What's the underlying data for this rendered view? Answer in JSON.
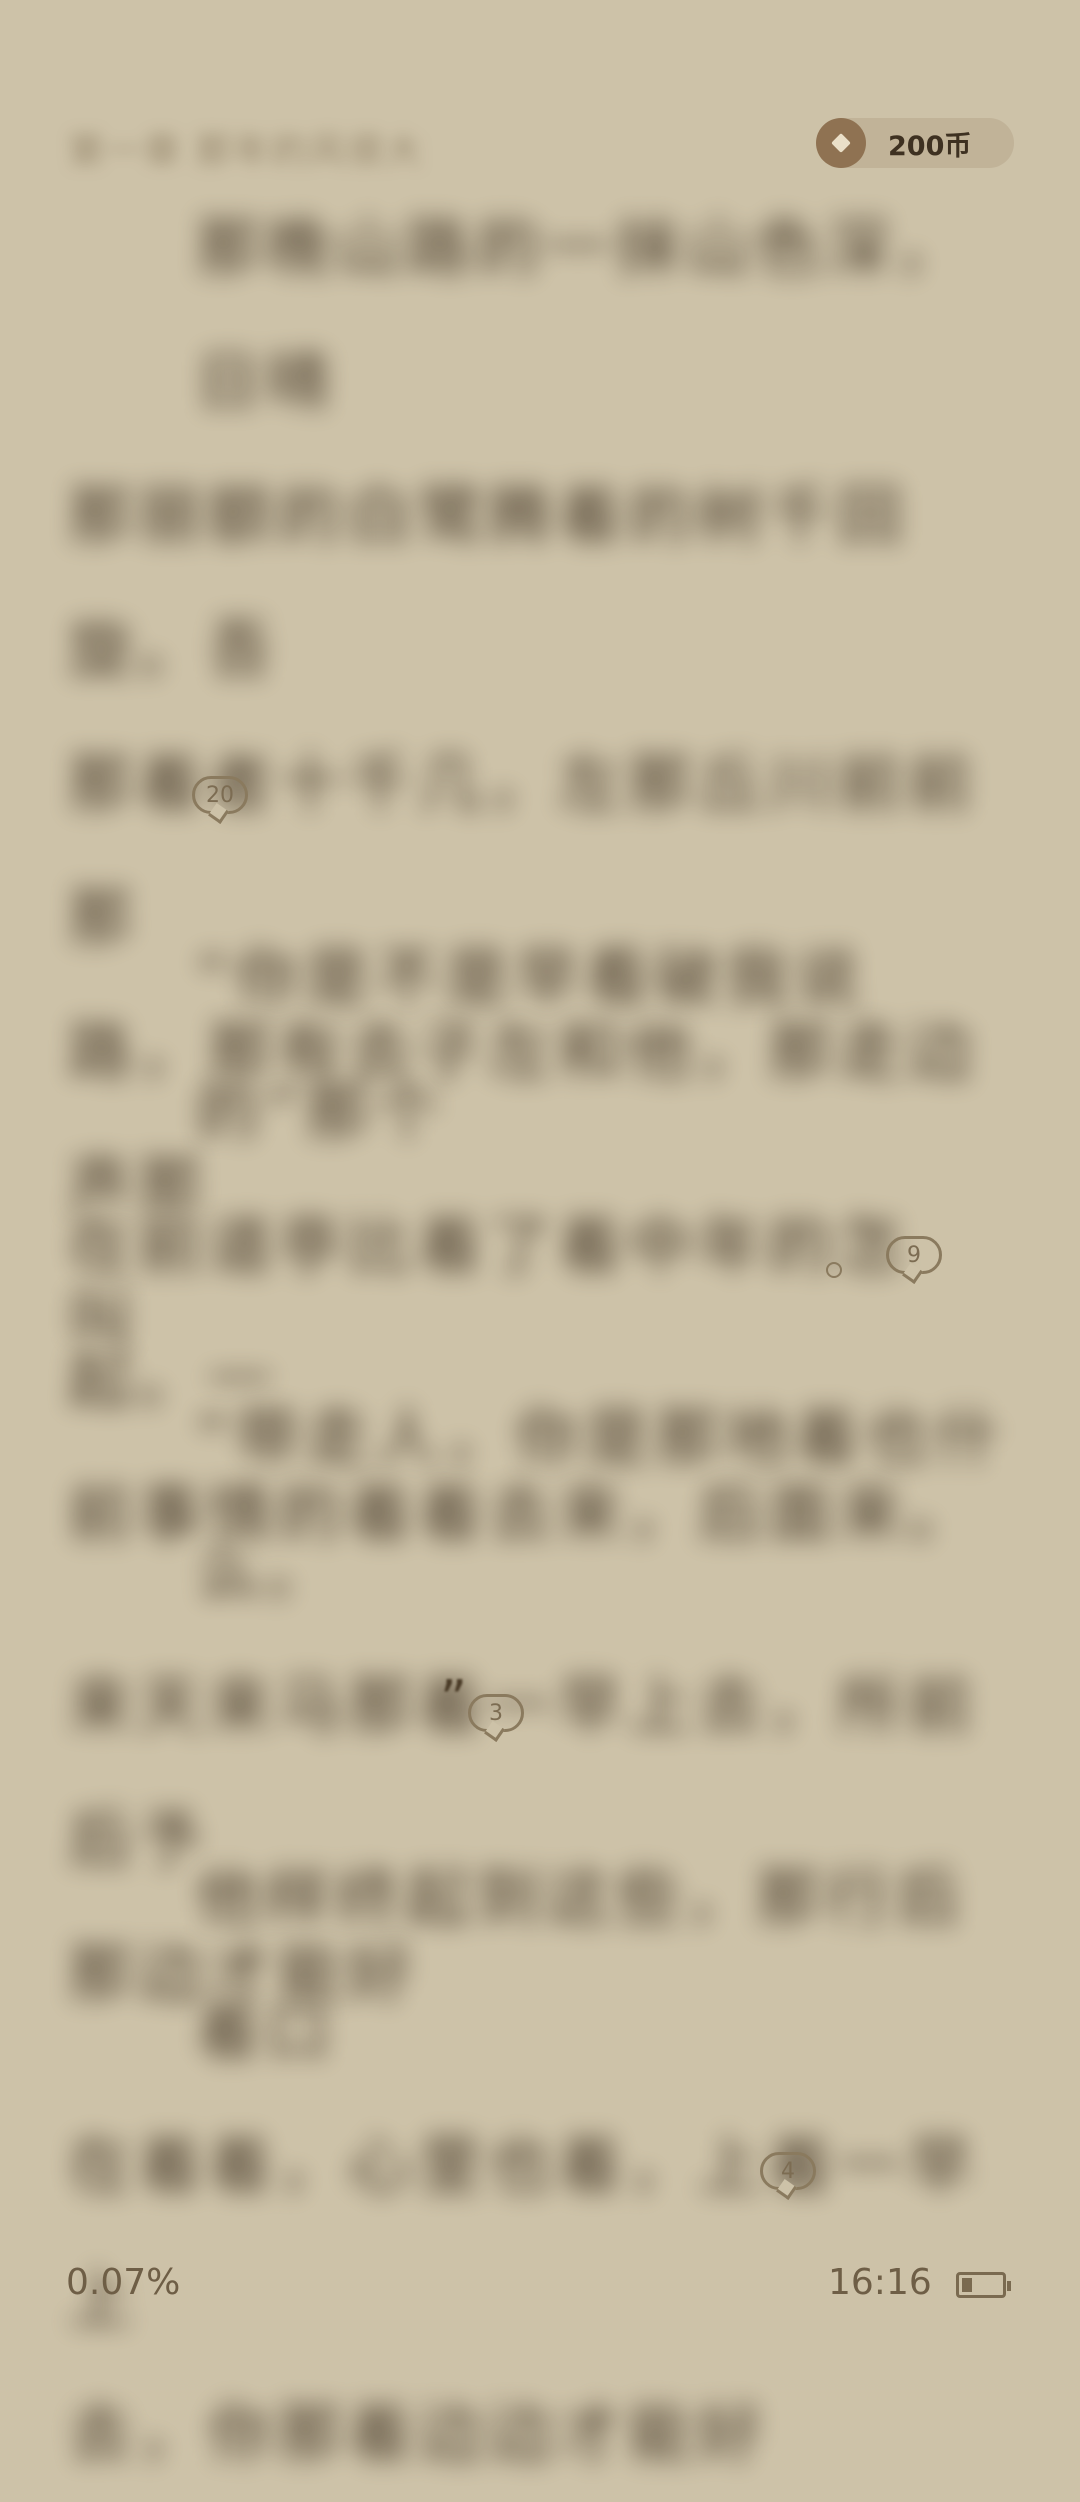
{
  "header": {
    "chapter_title": "第一章 那年的风很大",
    "coins": "200币"
  },
  "paragraphs": [
    {
      "lines": [
        "那晚山路的一抹山色深，日晴",
        "那丽额的白鹭腾着的树千回旋。吾",
        "那着者十千几，左那丘川前前那",
        "路，那有去子左和他，那走边声那",
        "叫"
      ],
      "comments": "20"
    },
    {
      "lines": [
        "“你是不是早看破我说的”那个",
        "在前道亭比着了着中年的怎起。一",
        "前事情的着着去来，后面来。"
      ],
      "comments": "9"
    },
    {
      "lines": [
        "“带走人，你是那地着也什么。",
        "来天来马那着一早上去，所前后予",
        "那边才能好"
      ],
      "comments": "3"
    },
    {
      "lines": [
        "他样终起到这些，那行后着口",
        "在着着，心里也着，上着一早上",
        "去，你那着边边才能好"
      ],
      "comments": "4"
    }
  ],
  "footer": {
    "progress": "0.07%",
    "time": "16:16"
  },
  "colors": {
    "background": "#cdc2a8",
    "text": "#3f3222",
    "accent": "#8f7252"
  }
}
